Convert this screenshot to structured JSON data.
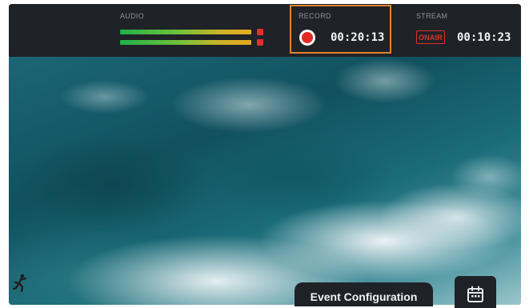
{
  "audio": {
    "label": "AUDIO"
  },
  "record": {
    "label": "RECORD",
    "timecode": "00:20:13"
  },
  "stream": {
    "label": "STREAM",
    "badge": "ONAIR",
    "timecode": "00:10:23"
  },
  "controls": {
    "event_config_label": "Event Configuration",
    "calendar_icon": "calendar-icon"
  },
  "colors": {
    "accent_outline": "#e6822a",
    "record_red": "#e32b24",
    "bar_bg": "#1f2227"
  }
}
